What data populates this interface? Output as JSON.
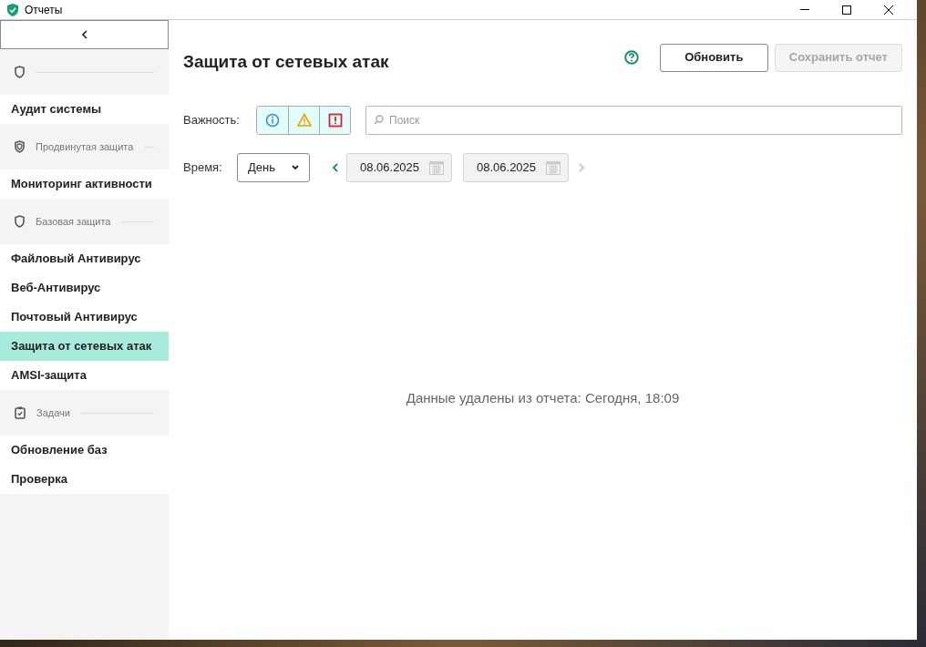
{
  "window": {
    "title": "Отчеты"
  },
  "sidebar": {
    "groups": [
      {
        "items": [
          {
            "label": "Аудит системы",
            "selected": false
          }
        ]
      },
      {
        "label": "Продвинутая защита",
        "items": [
          {
            "label": "Мониторинг активности",
            "selected": false
          }
        ]
      },
      {
        "label": "Базовая защита",
        "items": [
          {
            "label": "Файловый Антивирус",
            "selected": false
          },
          {
            "label": "Веб-Антивирус",
            "selected": false
          },
          {
            "label": "Почтовый Антивирус",
            "selected": false
          },
          {
            "label": "Защита от сетевых атак",
            "selected": true
          },
          {
            "label": "AMSI-защита",
            "selected": false
          }
        ]
      },
      {
        "label": "Задачи",
        "items": [
          {
            "label": "Обновление баз",
            "selected": false
          },
          {
            "label": "Проверка",
            "selected": false
          }
        ]
      }
    ]
  },
  "header": {
    "title": "Защита от сетевых атак",
    "buttons": [
      {
        "label": "Обновить",
        "disabled": false
      },
      {
        "label": "Сохранить отчет",
        "disabled": true
      }
    ]
  },
  "severity": {
    "label": "Важность:",
    "toggles": [
      {
        "selected": true
      },
      {
        "selected": true
      },
      {
        "selected": true
      }
    ]
  },
  "search": {
    "placeholder": "Поиск"
  },
  "time": {
    "label": "Время:",
    "period": "День",
    "prev_disabled": false,
    "next_disabled": true,
    "dates": [
      "08.06.2025",
      "08.06.2025"
    ]
  },
  "message": "Данные удалены из отчета: Сегодня, 18:09"
}
